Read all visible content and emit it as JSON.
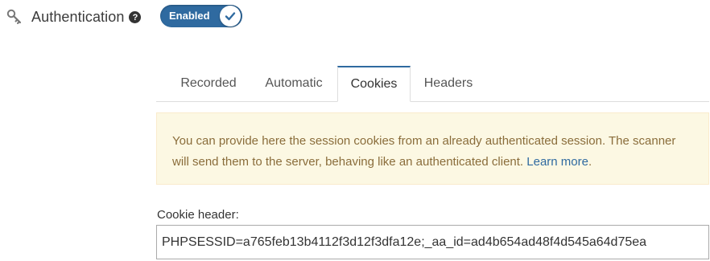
{
  "section": {
    "title": "Authentication",
    "help_icon": "question-circle-icon",
    "toggle": {
      "label": "Enabled",
      "state": "on",
      "color": "#2f6aa0"
    }
  },
  "tabs": [
    {
      "label": "Recorded",
      "active": false
    },
    {
      "label": "Automatic",
      "active": false
    },
    {
      "label": "Cookies",
      "active": true
    },
    {
      "label": "Headers",
      "active": false
    }
  ],
  "info": {
    "text": "You can provide here the session cookies from an already authenticated session. The scanner will send them to the server, behaving like an authenticated client.",
    "link_text": "Learn more",
    "trailing": "."
  },
  "cookie_header": {
    "label": "Cookie header:",
    "value": "PHPSESSID=a765feb13b4112f3d12f3dfa12e;_aa_id=ad4b654ad48f4d545a64d75ea"
  },
  "colors": {
    "accent": "#2f6aa0",
    "alert_bg": "#fcf8e3",
    "alert_text": "#8a6d3b"
  }
}
